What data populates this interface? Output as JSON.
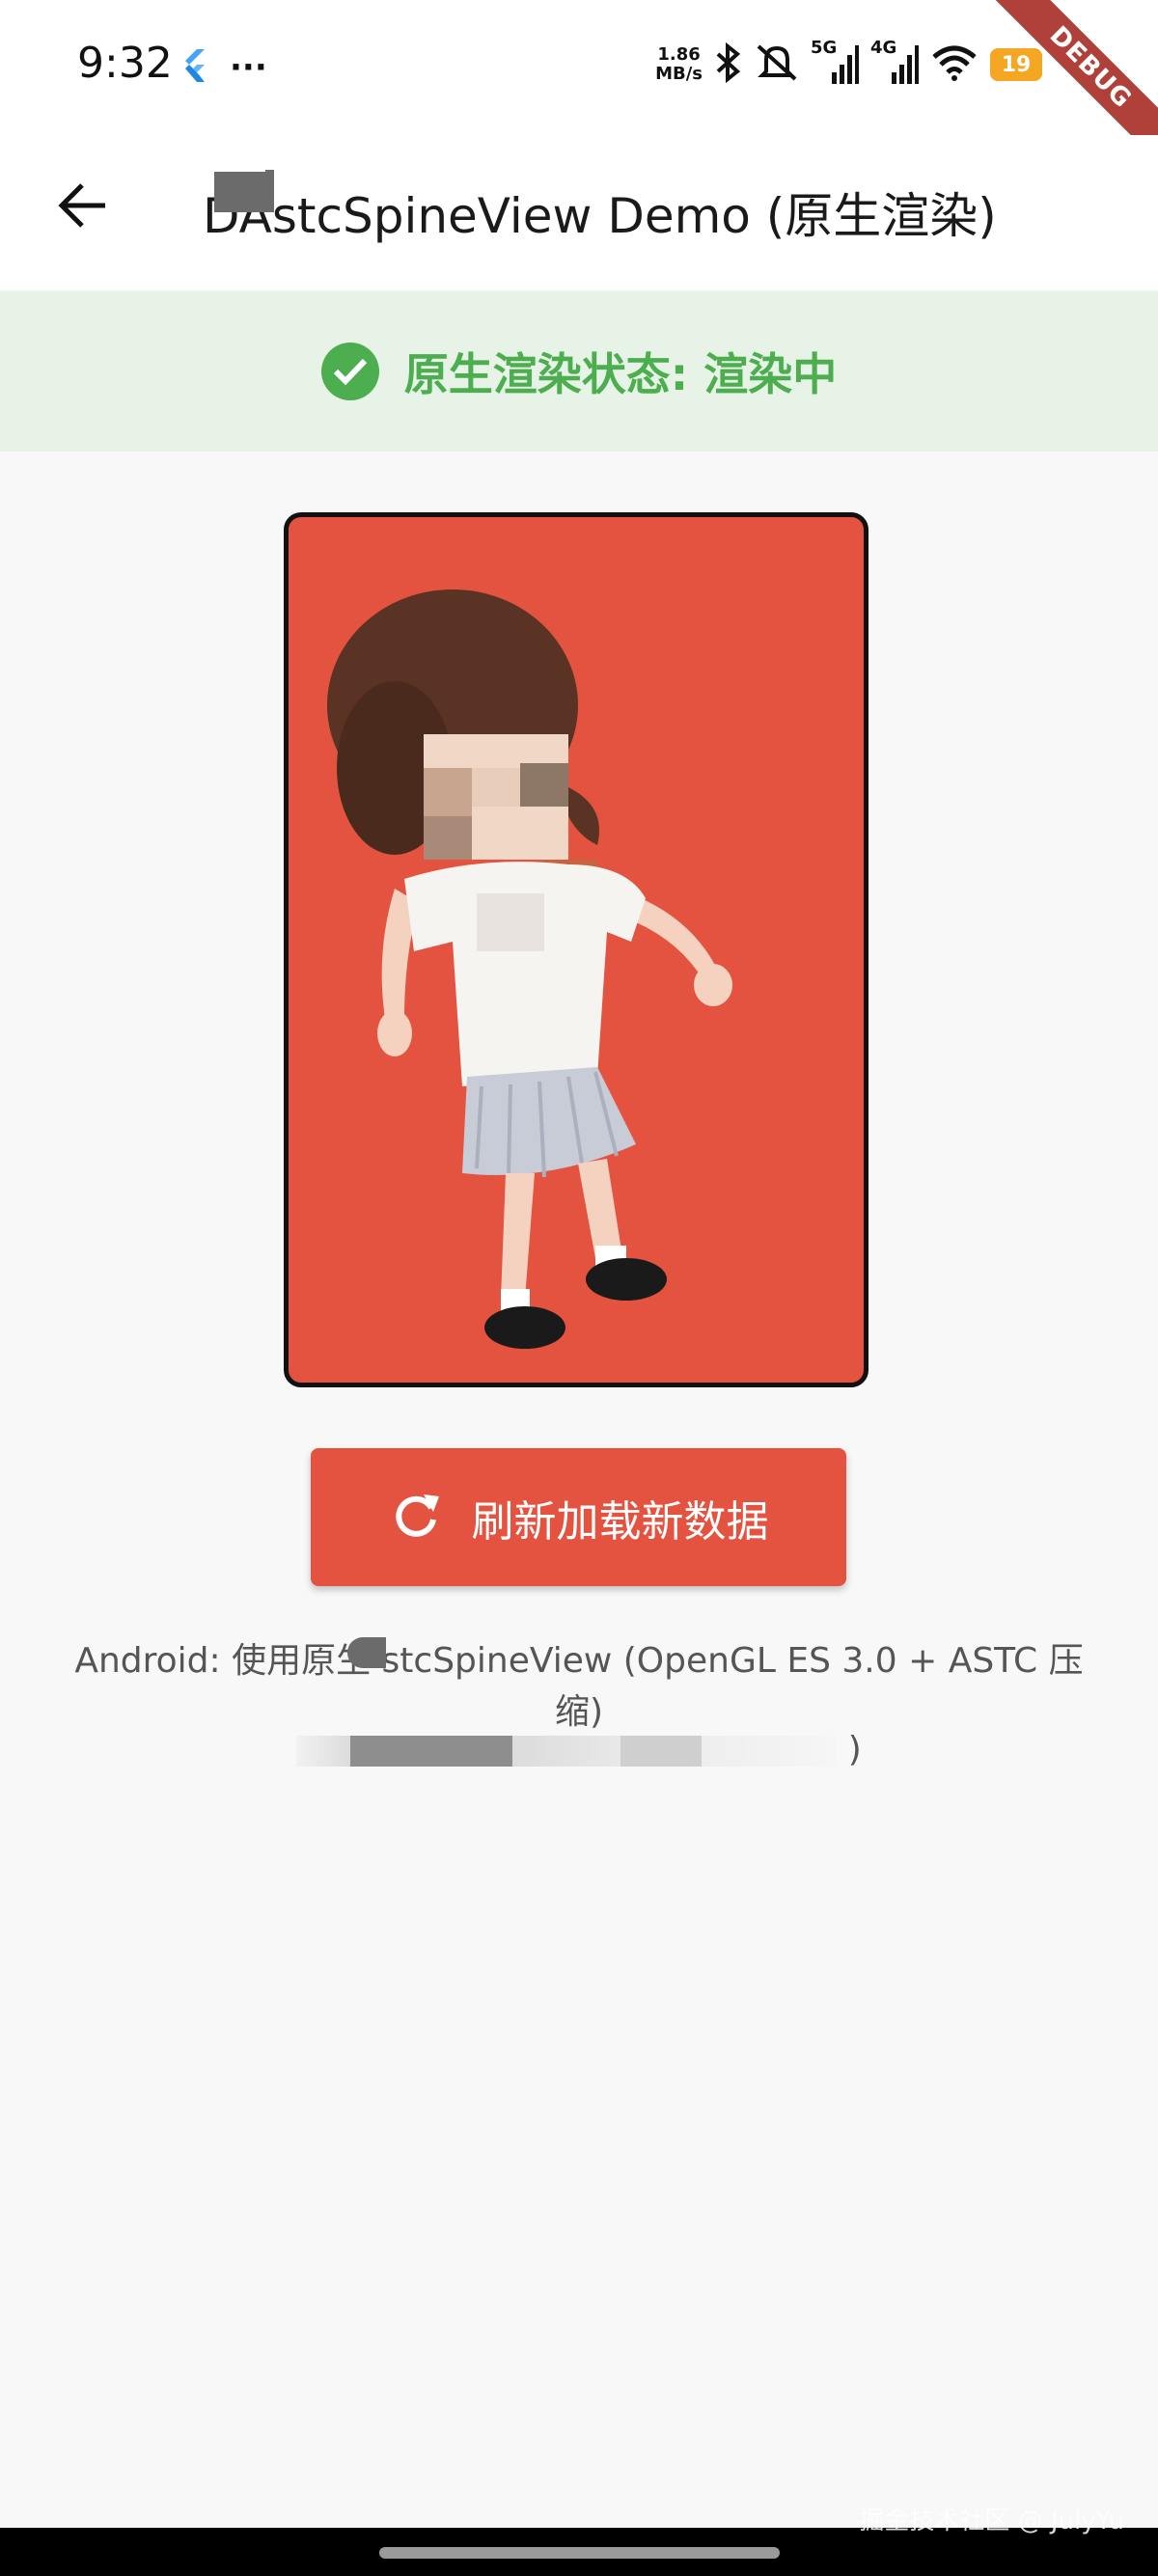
{
  "status_bar": {
    "time": "9:32",
    "more_indicator": "···",
    "net_speed_value": "1.86",
    "net_speed_unit": "MB/s",
    "sim1_label": "5G",
    "sim2_label": "4G",
    "battery_level": "19",
    "icons": [
      "flutter-icon",
      "bluetooth-icon",
      "mute-icon",
      "signal-5g-icon",
      "signal-4g-icon",
      "wifi-icon",
      "battery-icon"
    ]
  },
  "debug_banner": "DEBUG",
  "app_bar": {
    "title": "DAstcSpineView Demo (原生渲染)",
    "back_icon": "arrow-back-icon"
  },
  "status_banner": {
    "text": "原生渲染状态: 渲染中",
    "icon": "check-circle-icon",
    "accent": "#4CAE4F"
  },
  "spine_view": {
    "background": "#E35340",
    "content": "animated-character"
  },
  "refresh_button": {
    "label": "刷新加载新数据",
    "icon": "refresh-icon",
    "color": "#E35340"
  },
  "info": {
    "line1": "Android: 使用原生 stcSpineView (OpenGL ES 3.0 + ASTC 压",
    "line2": "缩)",
    "line3": ")"
  },
  "watermark": "掘金技术社区 @ JulyYu"
}
